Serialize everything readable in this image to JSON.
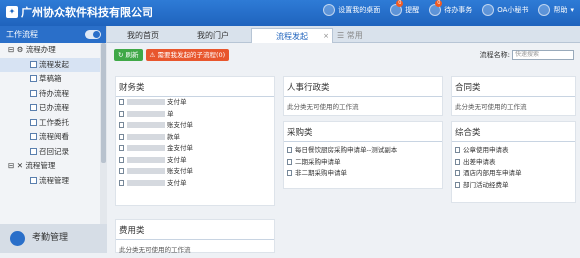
{
  "header": {
    "logo_text": "广州协众软件科技有限公司",
    "nav": [
      {
        "label": "设置我的桌面",
        "icon": "monitor-icon",
        "badge": ""
      },
      {
        "label": "提醒",
        "icon": "bell-icon",
        "badge": "0"
      },
      {
        "label": "待办事务",
        "icon": "task-icon",
        "badge": "0"
      },
      {
        "label": "OA小秘书",
        "icon": "chat-icon",
        "badge": ""
      },
      {
        "label": "帮助",
        "icon": "help-icon",
        "badge": ""
      }
    ]
  },
  "sidebar": {
    "title": "工作流程",
    "items": [
      {
        "label": "流程办理",
        "level": 1
      },
      {
        "label": "流程发起",
        "level": 2,
        "active": true
      },
      {
        "label": "草稿箱",
        "level": 2
      },
      {
        "label": "待办流程",
        "level": 2
      },
      {
        "label": "已办流程",
        "level": 2
      },
      {
        "label": "工作委托",
        "level": 2
      },
      {
        "label": "流程阅看",
        "level": 2
      },
      {
        "label": "召回记录",
        "level": 2
      },
      {
        "label": "流程管理",
        "level": 1
      },
      {
        "label": "流程管理",
        "level": 2
      }
    ],
    "footer": "考勤管理"
  },
  "tabs": [
    {
      "label": "我的首页"
    },
    {
      "label": "我的门户"
    },
    {
      "label": "流程发起",
      "active": true,
      "close": "×"
    },
    {
      "label": "常用"
    }
  ],
  "toolbar": {
    "refresh": "刷新",
    "pending": "需要我发起的子流程(0)"
  },
  "search": {
    "label": "流程名称:",
    "placeholder": "快速搜索"
  },
  "panels": {
    "finance": {
      "title": "财务类",
      "items": [
        "支付单",
        "单",
        "账支付单",
        "款单",
        "金支付单",
        "支付单",
        "账支付单",
        "支付单"
      ]
    },
    "cost": {
      "title": "费用类",
      "empty": "此分类无可使用的工作流"
    },
    "hr": {
      "title": "人事行政类",
      "empty": "此分类无可使用的工作流"
    },
    "purchase": {
      "title": "采购类",
      "items": [
        "每日餐饮厨房采购申请单--测试副本",
        "二期采购申请单",
        "非二期采购申请单"
      ]
    },
    "contract": {
      "title": "合同类",
      "empty": "此分类无可使用的工作流"
    },
    "general": {
      "title": "综合类",
      "items": [
        "公章使用申请表",
        "出差申请表",
        "酒店内部用车申请单",
        "部门活动经费单"
      ]
    }
  }
}
